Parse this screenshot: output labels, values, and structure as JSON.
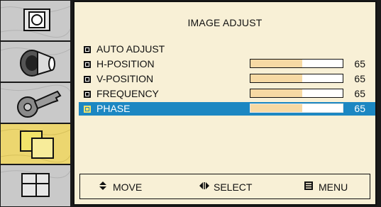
{
  "osd": {
    "title": "IMAGE ADJUST",
    "side_icons": [
      {
        "name": "image-size-icon",
        "selected": false
      },
      {
        "name": "lens-focus-icon",
        "selected": false
      },
      {
        "name": "key-setup-icon",
        "selected": false
      },
      {
        "name": "image-adjust-icon",
        "selected": true
      },
      {
        "name": "window-layout-icon",
        "selected": false
      }
    ],
    "items": [
      {
        "label": "AUTO ADJUST"
      },
      {
        "label": "H-POSITION",
        "value": "65",
        "level": 0.56
      },
      {
        "label": "V-POSITION",
        "value": "65",
        "level": 0.56
      },
      {
        "label": "FREQUENCY",
        "value": "65",
        "level": 0.56
      },
      {
        "label": "PHASE",
        "value": "65",
        "level": 0.56,
        "selected": true
      }
    ],
    "help": {
      "move_label": "MOVE",
      "move_icon": "up-down-arrows-icon",
      "select_label": "SELECT",
      "select_icon": "left-right-arrows-icon",
      "menu_label": "MENU",
      "menu_icon": "menu-grid-icon"
    },
    "colors": {
      "panel_bg": "#f8f0d6",
      "selected_row": "#1c87c2",
      "slider_fill": "#f6d9a4",
      "selected_tile": "#ecd66f"
    }
  }
}
